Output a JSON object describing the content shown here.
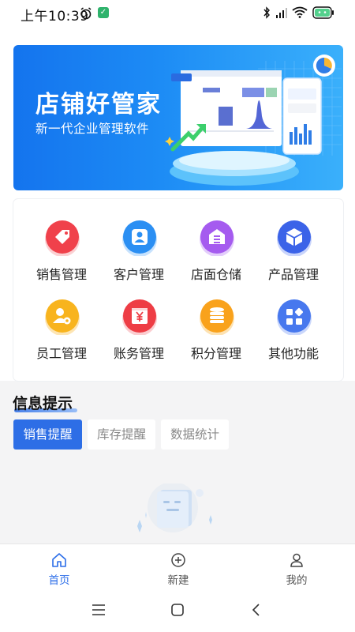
{
  "status_bar": {
    "time": "上午10:39",
    "icons": [
      "alarm-icon",
      "app-notification-icon",
      "bluetooth-icon",
      "signal-icon",
      "wifi-icon",
      "battery-icon"
    ]
  },
  "banner": {
    "title": "店铺好管家",
    "subtitle": "新一代企业管理软件"
  },
  "features": [
    {
      "label": "销售管理",
      "icon": "price-tag-icon",
      "color": "#f0414b"
    },
    {
      "label": "客户管理",
      "icon": "person-icon",
      "color": "#2b8ff3"
    },
    {
      "label": "店面仓储",
      "icon": "warehouse-icon",
      "color": "#a55bef"
    },
    {
      "label": "产品管理",
      "icon": "cube-icon",
      "color": "#3b63e8"
    },
    {
      "label": "员工管理",
      "icon": "staff-settings-icon",
      "color": "#f8b41e"
    },
    {
      "label": "账务管理",
      "icon": "ledger-yen-icon",
      "color": "#ee3d45"
    },
    {
      "label": "积分管理",
      "icon": "coins-stack-icon",
      "color": "#f9a21c"
    },
    {
      "label": "其他功能",
      "icon": "apps-grid-icon",
      "color": "#4778ee"
    }
  ],
  "info": {
    "title": "信息提示",
    "tabs": [
      {
        "label": "销售提醒",
        "active": true
      },
      {
        "label": "库存提醒",
        "active": false
      },
      {
        "label": "数据统计",
        "active": false
      }
    ]
  },
  "bottom_nav": [
    {
      "label": "首页",
      "icon": "home-icon",
      "active": true
    },
    {
      "label": "新建",
      "icon": "add-circle-icon",
      "active": false
    },
    {
      "label": "我的",
      "icon": "user-icon",
      "active": false
    }
  ],
  "colors": {
    "accent": "#2d6ee6",
    "banner_start": "#1474ee",
    "banner_end": "#3ab0fb",
    "page_bg": "#f4f4f5"
  }
}
